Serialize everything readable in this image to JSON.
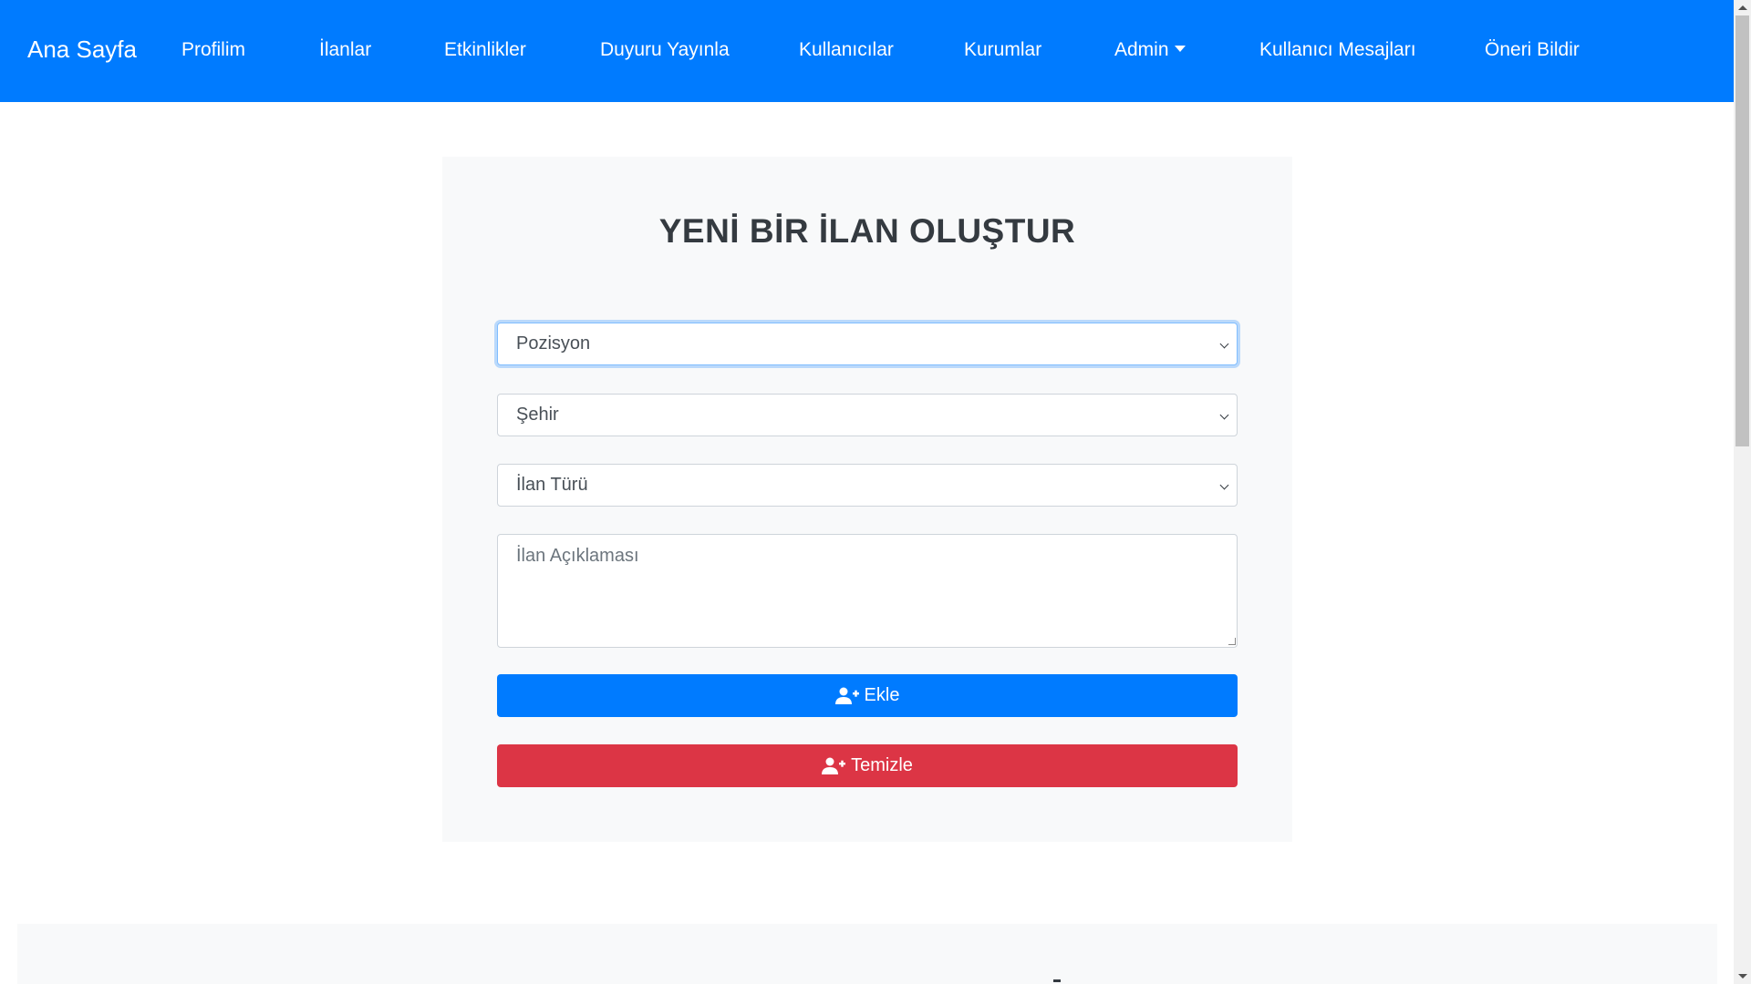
{
  "navbar": {
    "brand": "Ana Sayfa",
    "items": [
      {
        "label": "Profilim"
      },
      {
        "label": "İlanlar"
      },
      {
        "label": "Etkinlikler"
      },
      {
        "label": "Duyuru Yayınla"
      },
      {
        "label": "Kullanıcılar"
      },
      {
        "label": "Kurumlar"
      },
      {
        "label": "Admin",
        "dropdown": true
      },
      {
        "label": "Kullanıcı Mesajları"
      },
      {
        "label": "Öneri Bildir"
      }
    ],
    "color": "#007bff"
  },
  "form": {
    "title": "YENİ BİR İLAN OLUŞTUR",
    "position_select": "Pozisyon",
    "city_select": "Şehir",
    "type_select": "İlan Türü",
    "description_placeholder": "İlan Açıklaması",
    "add_button": "Ekle",
    "clear_button": "Temizle",
    "add_icon": "user-plus-icon",
    "clear_icon": "user-plus-icon",
    "primary_color": "#007bff",
    "danger_color": "#dc3545"
  }
}
